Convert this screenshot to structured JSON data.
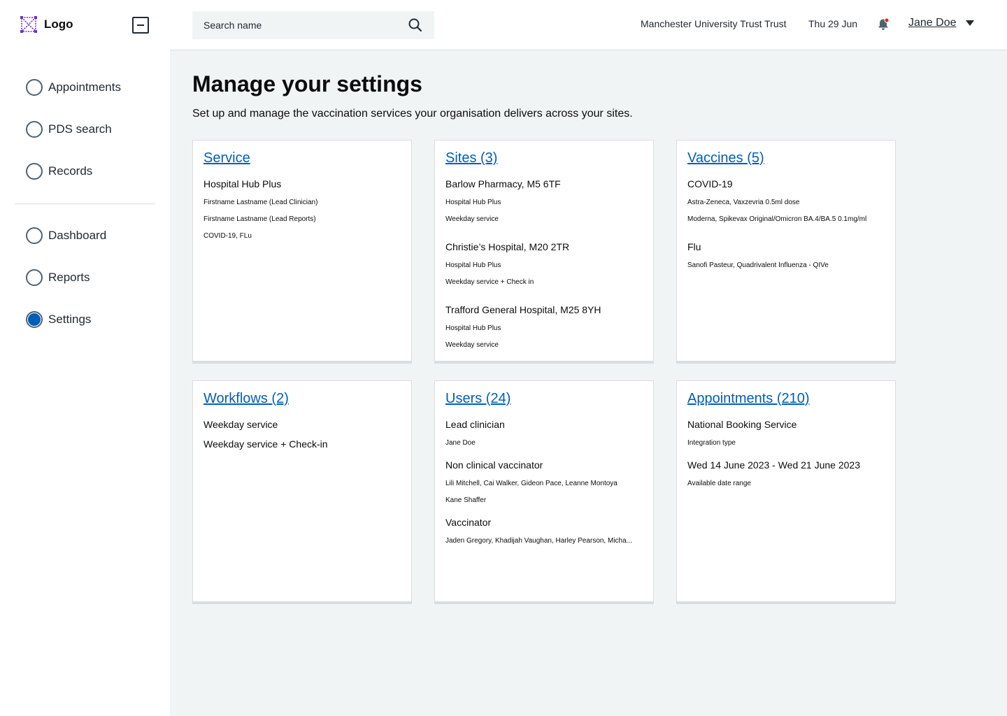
{
  "sidebar": {
    "logo_text": "Logo",
    "nav_primary": [
      {
        "label": "Appointments",
        "selected": false
      },
      {
        "label": "PDS search",
        "selected": false
      },
      {
        "label": "Records",
        "selected": false
      }
    ],
    "nav_secondary": [
      {
        "label": "Dashboard",
        "selected": false
      },
      {
        "label": "Reports",
        "selected": false
      },
      {
        "label": "Settings",
        "selected": true
      }
    ]
  },
  "header": {
    "search_placeholder": "Search name",
    "organisation": "Manchester University Trust Trust",
    "date": "Thu 29 Jun",
    "user_name": "Jane Doe",
    "notification_dot_color": "#d5281b"
  },
  "main": {
    "title": "Manage your settings",
    "description": "Set up and manage the vaccination services your organisation delivers across your sites."
  },
  "cards": {
    "service": {
      "title": "Service",
      "name": "Hospital Hub Plus",
      "lead_clinician": "Firstname Lastname (Lead Clinician)",
      "lead_reports": "Firstname Lastname (Lead Reports)",
      "vaccines": "COVID-19, FLu"
    },
    "sites": {
      "title": "Sites (3)",
      "items": [
        {
          "name": "Barlow Pharmacy, M5 6TF",
          "type": "Hospital Hub Plus",
          "workflow": "Weekday service"
        },
        {
          "name": "Christie’s Hospital, M20 2TR",
          "type": "Hospital Hub Plus",
          "workflow": "Weekday service + Check in"
        },
        {
          "name": "Trafford General Hospital, M25 8YH",
          "type": "Hospital Hub Plus",
          "workflow": "Weekday service"
        }
      ]
    },
    "vaccines": {
      "title": "Vaccines (5)",
      "covid_heading": "COVID-19",
      "covid_1": "Astra-Zeneca, Vaxzevria 0.5ml dose",
      "covid_2": "Moderna, Spikevax Original/Omicron BA.4/BA.5 0.1mg/ml",
      "flu_heading": "Flu",
      "flu_1": "Sanofi Pasteur, Quadrivalent Influenza - QIVe"
    },
    "workflows": {
      "title": "Workflows (2)",
      "item_1": "Weekday service",
      "item_2": "Weekday service + Check-in"
    },
    "users": {
      "title": "Users (24)",
      "role_1": "Lead clinician",
      "role_1_names": "Jane Doe",
      "role_2": "Non clinical vaccinator",
      "role_2_names_line1": "Lili Mitchell, Cai Walker, Gideon Pace, Leanne Montoya",
      "role_2_names_line2": "Kane Shaffer",
      "role_3": "Vaccinator",
      "role_3_names": "Jaden Gregory, Khadijah Vaughan, Harley Pearson, Micha..."
    },
    "appointments": {
      "title": "Appointments (210)",
      "booking": "National Booking Service",
      "booking_label": "Integration type",
      "date_range": "Wed 14 June 2023 - Wed 21 June 2023",
      "date_range_label": "Available date range"
    }
  }
}
